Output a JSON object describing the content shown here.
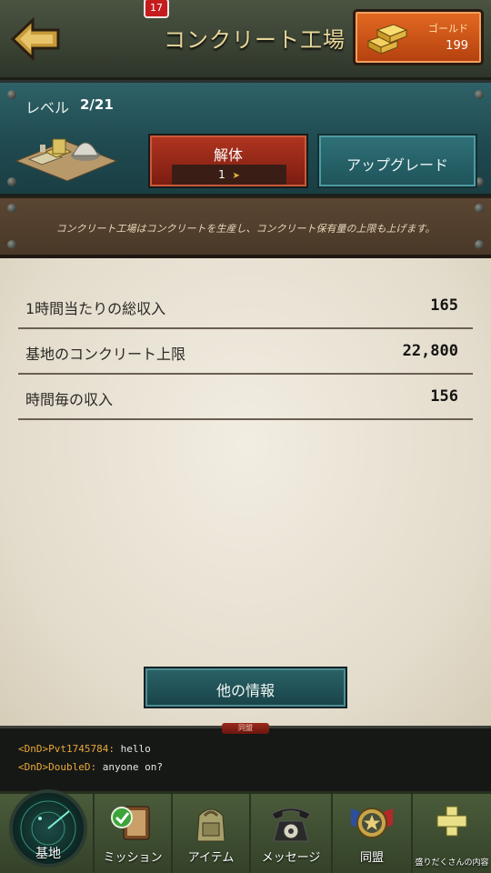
{
  "header": {
    "title": "コンクリート工場",
    "gold_label": "ゴールド",
    "gold_value": "199"
  },
  "building": {
    "level_label": "レベル",
    "level_value": "2/21",
    "demolish_label": "解体",
    "demolish_cost": "1",
    "upgrade_label": "アップグレード",
    "description": "コンクリート工場はコンクリートを生産し、コンクリート保有量の上限も上げます。"
  },
  "stats": [
    {
      "label": "1時間当たりの総収入",
      "value": "165"
    },
    {
      "label": "基地のコンクリート上限",
      "value": "22,800"
    },
    {
      "label": "時間毎の収入",
      "value": "156"
    }
  ],
  "more_info_label": "他の情報",
  "chat": {
    "tab_label": "同盟",
    "messages": [
      {
        "tag": "<DnD>Pvt1745784:",
        "text": " hello"
      },
      {
        "tag": "<DnD>DoubleD:",
        "text": " anyone on?"
      }
    ]
  },
  "nav": {
    "base": "基地",
    "missions": "ミッション",
    "missions_badge": "17",
    "items": "アイテム",
    "messages": "メッセージ",
    "alliance": "同盟",
    "extra": "盛りだくさんの内容"
  },
  "colors": {
    "accent_teal": "#1f4a50",
    "gold_orange": "#e46a22",
    "demolish_red": "#b03520"
  }
}
